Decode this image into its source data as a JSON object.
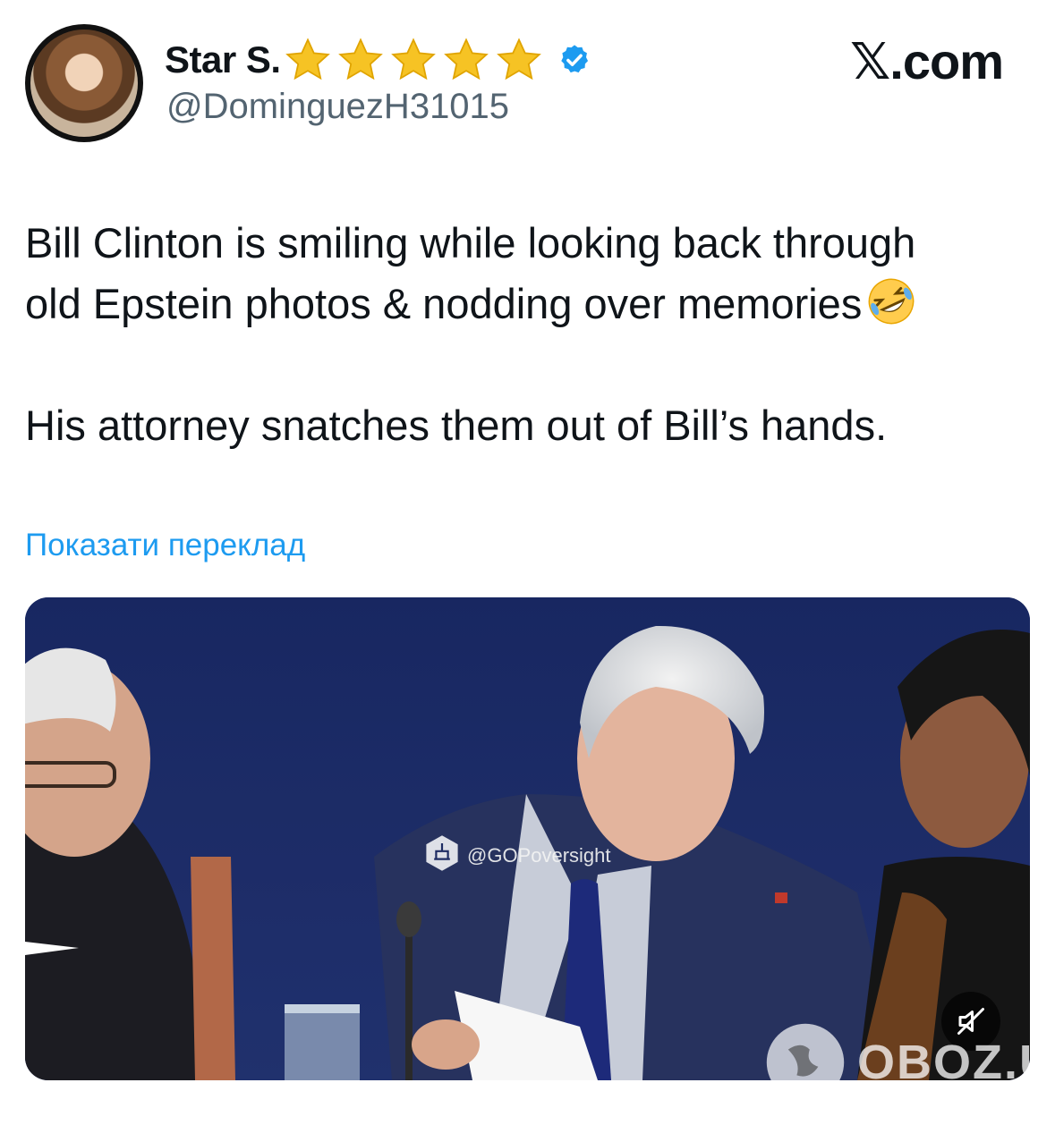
{
  "post": {
    "display_name": "Star S.",
    "handle": "@DominguezH31015",
    "star_count": 5,
    "verified": true,
    "site_logo": "𝕏.com",
    "text_line_1": "Bill Clinton is smiling while looking back through",
    "text_line_2": "old Epstein photos & nodding over memories",
    "text_line_3": "His attorney snatches them out of Bill’s hands.",
    "emoji": "rolling-on-floor-laughing",
    "translate_label": "Показати переклад"
  },
  "media": {
    "watermark": "@GOPoversight",
    "mute_icon": "muted-speaker-icon",
    "publisher_watermark": "OBOZ.UA"
  },
  "colors": {
    "link": "#1d9bf0",
    "verified": "#1d9bf0",
    "star": "#f6c324",
    "handle": "#536471",
    "video_background": "#1e2c63"
  }
}
